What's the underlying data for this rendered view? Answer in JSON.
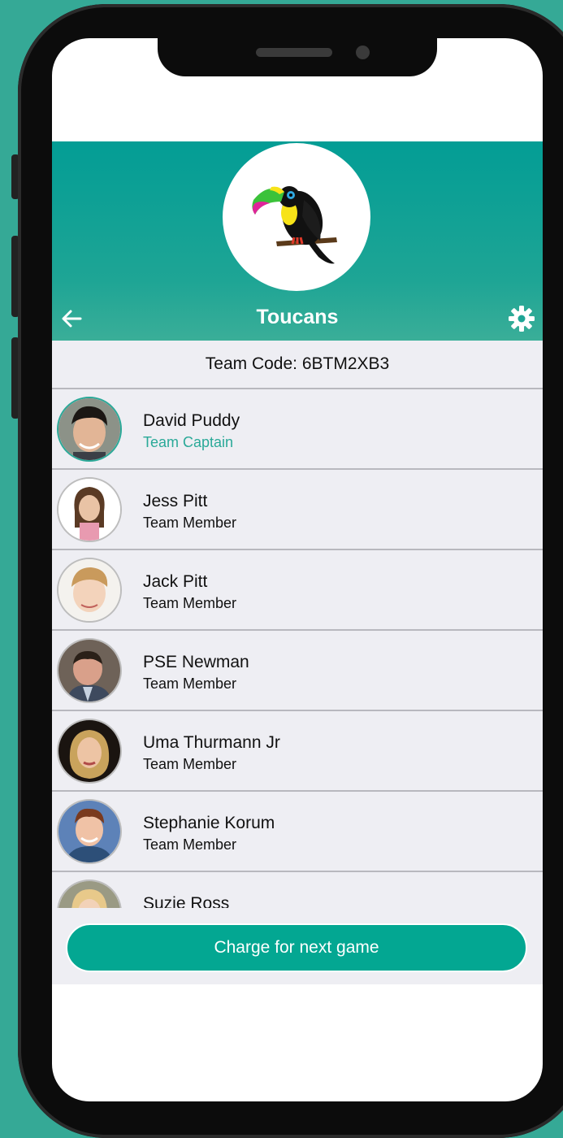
{
  "header": {
    "team_name": "Toucans",
    "back_icon": "arrow-left-icon",
    "settings_icon": "gear-icon"
  },
  "team_code": "Team Code: 6BTM2XB3",
  "members": [
    {
      "name": "David Puddy",
      "role": "Team Captain",
      "captain": true
    },
    {
      "name": "Jess Pitt",
      "role": "Team Member",
      "captain": false
    },
    {
      "name": "Jack Pitt",
      "role": "Team Member",
      "captain": false
    },
    {
      "name": "PSE Newman",
      "role": "Team Member",
      "captain": false
    },
    {
      "name": "Uma Thurmann Jr",
      "role": "Team Member",
      "captain": false
    },
    {
      "name": "Stephanie Korum",
      "role": "Team Member",
      "captain": false
    },
    {
      "name": "Suzie Ross",
      "role": "",
      "captain": false
    }
  ],
  "charge_button": {
    "label": "Charge for next game"
  },
  "colors": {
    "accent": "#03a792",
    "header": "#039d95",
    "background": "#35a996",
    "list_bg": "#eeeef3"
  }
}
